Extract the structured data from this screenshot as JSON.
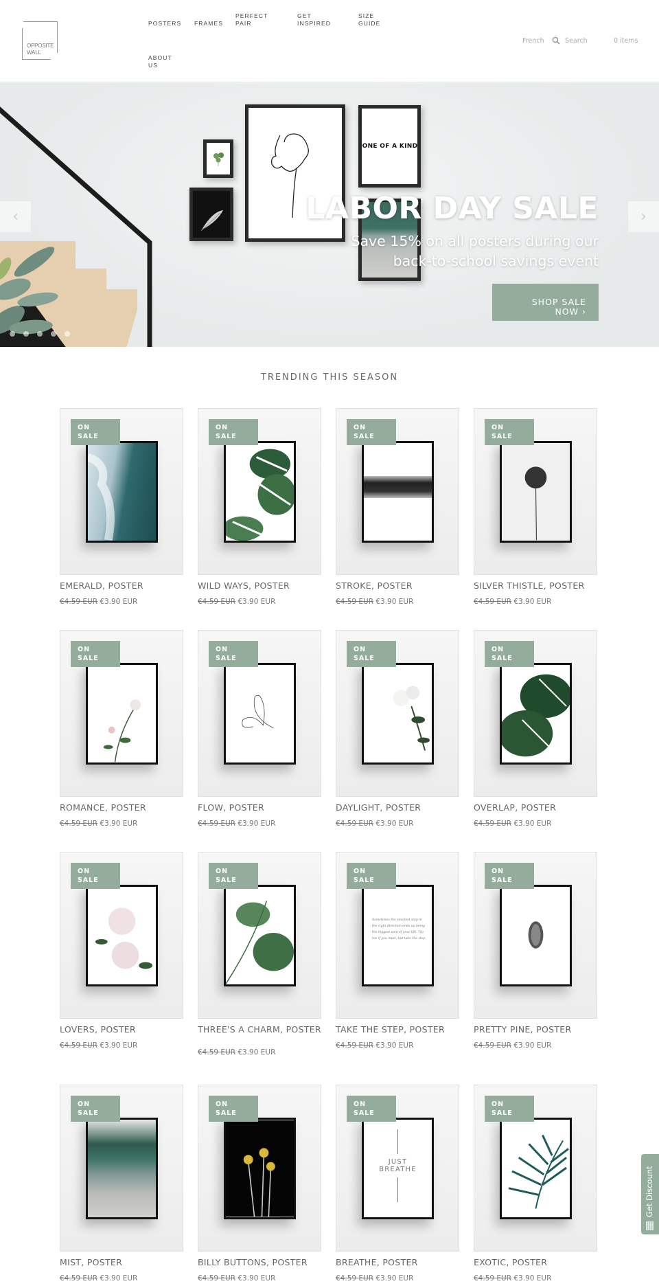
{
  "header": {
    "logo": [
      "OPPOSITE",
      "WALL"
    ],
    "nav": [
      {
        "label": "POSTERS"
      },
      {
        "label": "FRAMES"
      },
      {
        "label": "PERFECT PAIR"
      },
      {
        "label": "GET INSPIRED"
      },
      {
        "label": "SIZE GUIDE"
      },
      {
        "label": "ABOUT US"
      }
    ],
    "language": "French",
    "search_placeholder": "Search",
    "cart": "0 items"
  },
  "hero": {
    "title": "LABOR DAY SALE",
    "subtitle": "Save 15% on all posters during our back-to-school savings event",
    "cta": "SHOP SALE NOW",
    "cta_icon": "chevron-right-icon",
    "slide_count": 5,
    "active_slide": 1,
    "frame_text": "ONE OF A KIND"
  },
  "trending": {
    "title": "TRENDING THIS SEASON",
    "badge": "ON SALE",
    "products": [
      {
        "name": "EMERALD, POSTER",
        "old_price": "€4.59 EUR",
        "price": "€3.90 EUR",
        "art": "ocean"
      },
      {
        "name": "WILD WAYS, POSTER",
        "old_price": "€4.59 EUR",
        "price": "€3.90 EUR",
        "art": "monstera"
      },
      {
        "name": "STROKE, POSTER",
        "old_price": "€4.59 EUR",
        "price": "€3.90 EUR",
        "art": "stroke"
      },
      {
        "name": "SILVER THISTLE, POSTER",
        "old_price": "€4.59 EUR",
        "price": "€3.90 EUR",
        "art": "thistle"
      },
      {
        "name": "ROMANCE, POSTER",
        "old_price": "€4.59 EUR",
        "price": "€3.90 EUR",
        "art": "romance"
      },
      {
        "name": "FLOW, POSTER",
        "old_price": "€4.59 EUR",
        "price": "€3.90 EUR",
        "art": "flow"
      },
      {
        "name": "DAYLIGHT, POSTER",
        "old_price": "€4.59 EUR",
        "price": "€3.90 EUR",
        "art": "daylight"
      },
      {
        "name": "OVERLAP, POSTER",
        "old_price": "€4.59 EUR",
        "price": "€3.90 EUR",
        "art": "overlap"
      },
      {
        "name": "LOVERS, POSTER",
        "old_price": "€4.59 EUR",
        "price": "€3.90 EUR",
        "art": "lovers"
      },
      {
        "name": "THREE'S A CHARM, POSTER",
        "old_price": "€4.59 EUR",
        "price": "€3.90 EUR",
        "art": "charm"
      },
      {
        "name": "TAKE THE STEP, POSTER",
        "old_price": "€4.59 EUR",
        "price": "€3.90 EUR",
        "art": "step",
        "quote": "Sometimes the smallest step in the right direction ends up being the biggest step of your life. Tip toe if you must, but take the step."
      },
      {
        "name": "PRETTY PINE, POSTER",
        "old_price": "€4.59 EUR",
        "price": "€3.90 EUR",
        "art": "pine"
      },
      {
        "name": "MIST, POSTER",
        "old_price": "€4.59 EUR",
        "price": "€3.90 EUR",
        "art": "mist"
      },
      {
        "name": "BILLY BUTTONS, POSTER",
        "old_price": "€4.59 EUR",
        "price": "€3.90 EUR",
        "art": "billy"
      },
      {
        "name": "BREATHE, POSTER",
        "old_price": "€4.59 EUR",
        "price": "€3.90 EUR",
        "art": "breathe",
        "art_text": [
          "JUST",
          "BREATHE"
        ]
      },
      {
        "name": "EXOTIC, POSTER",
        "old_price": "€4.59 EUR",
        "price": "€3.90 EUR",
        "art": "exotic"
      }
    ]
  },
  "discount_tab": {
    "label": "Get Discount"
  },
  "colors": {
    "accent": "#93ac9c",
    "text": "#666666"
  }
}
